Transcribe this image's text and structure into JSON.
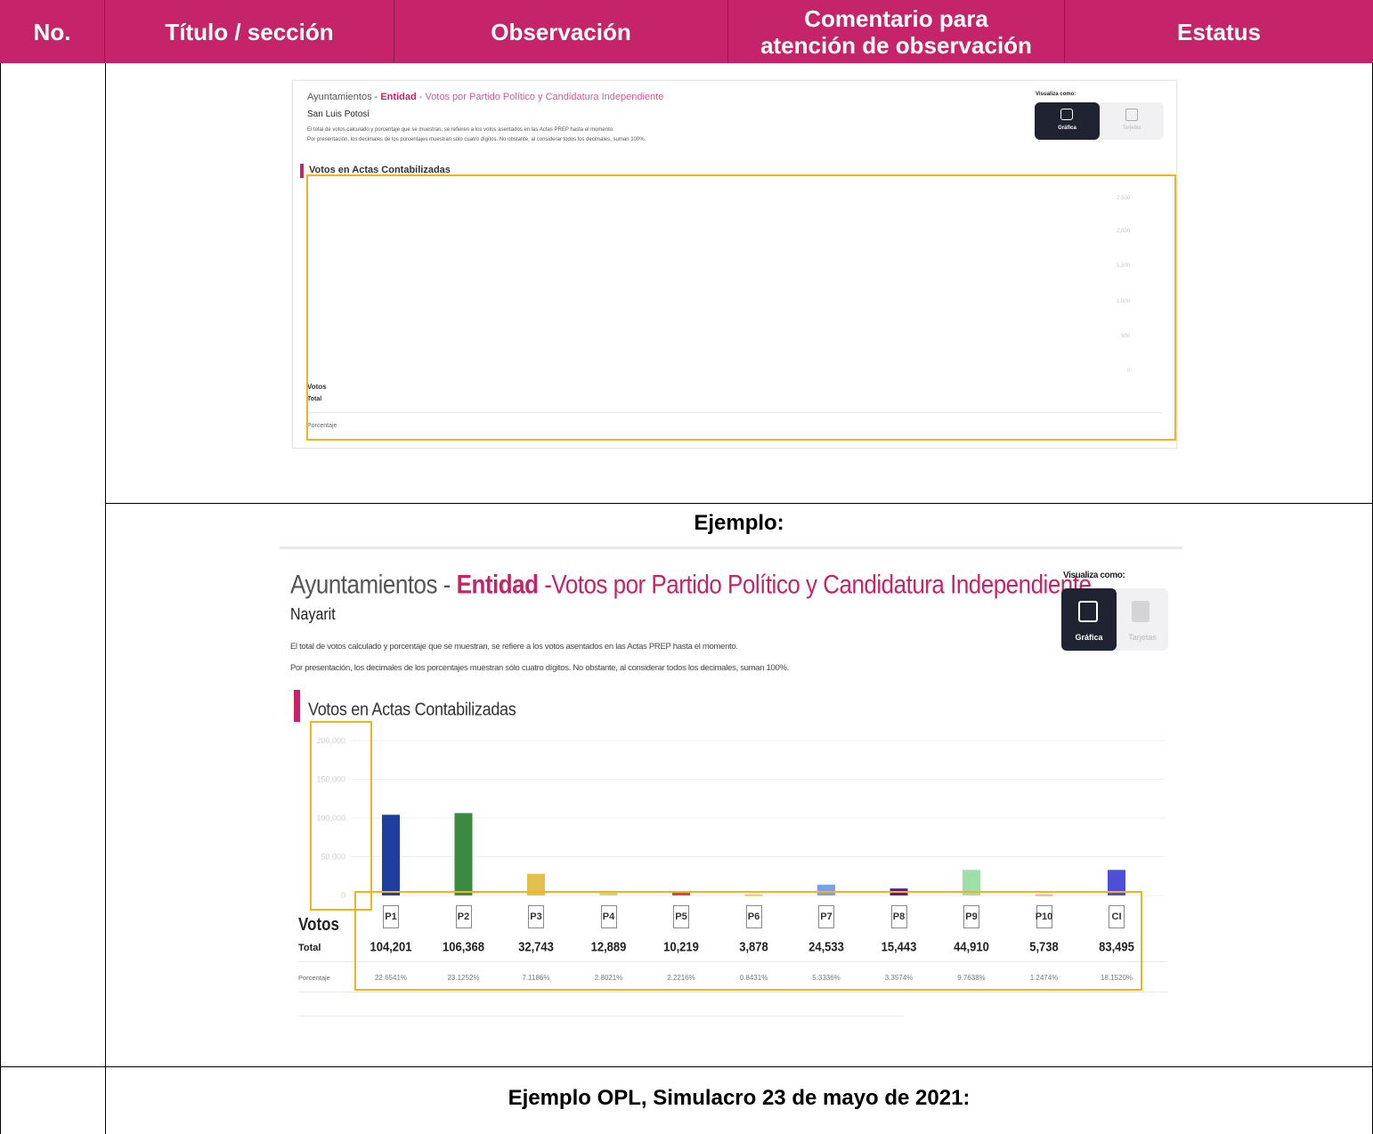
{
  "table": {
    "headers": {
      "no": "No.",
      "titulo": "Título / sección",
      "observacion": "Observación",
      "comentario_line1": "Comentario para",
      "comentario_line2": "atención de observación",
      "estatus": "Estatus"
    },
    "row_titles": {
      "ejemplo": "Ejemplo:",
      "ejemplo_opl": "Ejemplo OPL, Simulacro 23 de mayo de 2021:"
    }
  },
  "colors": {
    "header_bg": "#c5246b",
    "highlight": "#f2b320",
    "toggle_dark": "#1f2230"
  },
  "screenshot1": {
    "title_prefix": "Ayuntamientos - ",
    "title_entity": "Entidad",
    "title_suffix": " - Votos por Partido Político y Candidatura Independiente",
    "state": "San Luis Potosí",
    "note1": "El total de votos calculado y porcentaje que se muestran, se refieren a los votos asentados en las Actas PREP hasta el momento.",
    "note2": "Por presentación, los decimales de los porcentajes muestran sólo cuatro dígitos. No obstante, al considerar todos los decimales, suman 100%.",
    "view_label": "Visualiza como:",
    "btn_chart": "Gráfica",
    "btn_table": "Tarjetas",
    "section": "Votos en Actas Contabilizadas",
    "y_ticks": [
      "2,500",
      "2,000",
      "1,500",
      "1,000",
      "500",
      "0"
    ],
    "votos": "Votos",
    "total": "Total",
    "porcentaje": "Porcentaje"
  },
  "screenshot2": {
    "title_prefix": "Ayuntamientos - ",
    "title_entity": "Entidad",
    "title_suffix": " -Votos por Partido Político y Candidatura Independiente",
    "state": "Nayarit",
    "note1": "El total de votos calculado y porcentaje que se muestran, se refiere a los votos asentados en las Actas PREP hasta el momento.",
    "note2": "Por presentación, los decimales de los porcentajes muestran sólo cuatro dígitos. No obstante, al considerar todos los decimales, suman 100%.",
    "view_label": "Visualiza como:",
    "btn_chart": "Gráfica",
    "btn_table": "Tarjetas",
    "section": "Votos en Actas Contabilizadas",
    "votos": "Votos",
    "total": "Total",
    "porcentaje": "Porcentaje"
  },
  "chart_data": {
    "type": "bar",
    "title": "Votos en Actas Contabilizadas",
    "categories": [
      "P1",
      "P2",
      "P3",
      "P4",
      "P5",
      "P6",
      "P7",
      "P8",
      "P9",
      "P10",
      "CI"
    ],
    "values": [
      104201,
      106368,
      32743,
      12889,
      10219,
      3878,
      24533,
      15443,
      44910,
      5738,
      83495
    ],
    "totals_text": [
      "104,201",
      "106,368",
      "32,743",
      "12,889",
      "10,219",
      "3,878",
      "24,533",
      "15,443",
      "44,910",
      "5,738",
      "83,495"
    ],
    "percent_text": [
      "22.6541%",
      "23.1252%",
      "7.1186%",
      "2.8021%",
      "2.2216%",
      "0.8431%",
      "5.3336%",
      "3.3574%",
      "9.7638%",
      "1.2474%",
      "18.1520%"
    ],
    "bar_heights_visible": [
      104201,
      106368,
      28000,
      6000,
      5000,
      1500,
      14000,
      9000,
      33000,
      1500,
      33000
    ],
    "colors": [
      "#1f3f9e",
      "#3a8a3f",
      "#e3c04b",
      "#c8d87a",
      "#d9473a",
      "#e8c07a",
      "#7aa3e6",
      "#5a1f7a",
      "#9ee0a8",
      "#f0b090",
      "#4d4fd6"
    ],
    "y_ticks": [
      "200,000",
      "150,000",
      "100,000",
      "50,000",
      "0"
    ],
    "ylim": [
      0,
      200000
    ],
    "grid": true
  }
}
